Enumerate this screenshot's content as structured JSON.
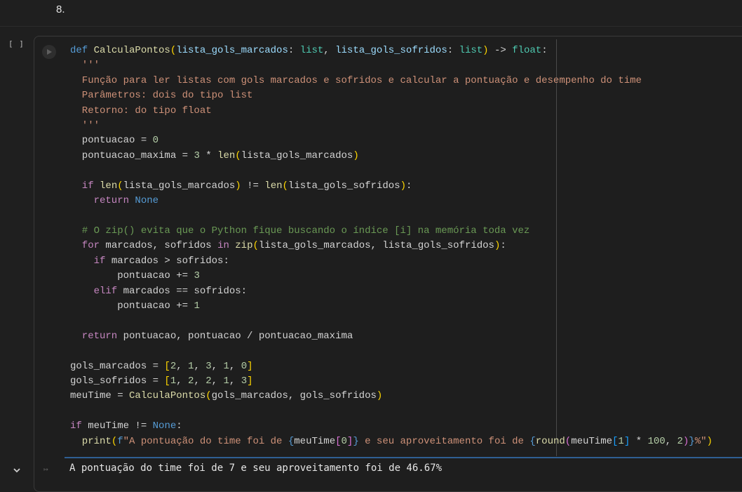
{
  "prev_cell": {
    "list_marker": "8."
  },
  "cell": {
    "execution_count": "[ ]",
    "code_lines": [
      [
        [
          "kw",
          "def "
        ],
        [
          "fn",
          "CalculaPontos"
        ],
        [
          "b1",
          "("
        ],
        [
          "pr",
          "lista_gols_marcados"
        ],
        [
          "tx",
          ": "
        ],
        [
          "ty",
          "list"
        ],
        [
          "tx",
          ", "
        ],
        [
          "pr",
          "lista_gols_sofridos"
        ],
        [
          "tx",
          ": "
        ],
        [
          "ty",
          "list"
        ],
        [
          "b1",
          ")"
        ],
        [
          "tx",
          " -> "
        ],
        [
          "ty",
          "float"
        ],
        [
          "tx",
          ":"
        ]
      ],
      [
        [
          "str",
          "  '''"
        ]
      ],
      [
        [
          "str",
          "  Função para ler listas com gols marcados e sofridos e calcular a pontuação e desempenho do time"
        ]
      ],
      [
        [
          "str",
          "  Parâmetros: dois do tipo list"
        ]
      ],
      [
        [
          "str",
          "  Retorno: do tipo float"
        ]
      ],
      [
        [
          "str",
          "  '''"
        ]
      ],
      [
        [
          "tx",
          "  pontuacao = "
        ],
        [
          "num",
          "0"
        ]
      ],
      [
        [
          "tx",
          "  pontuacao_maxima = "
        ],
        [
          "num",
          "3"
        ],
        [
          "tx",
          " * "
        ],
        [
          "fn",
          "len"
        ],
        [
          "b1",
          "("
        ],
        [
          "tx",
          "lista_gols_marcados"
        ],
        [
          "b1",
          ")"
        ]
      ],
      [
        [
          "tx",
          ""
        ]
      ],
      [
        [
          "ctl",
          "  if "
        ],
        [
          "fn",
          "len"
        ],
        [
          "b1",
          "("
        ],
        [
          "tx",
          "lista_gols_marcados"
        ],
        [
          "b1",
          ")"
        ],
        [
          "tx",
          " != "
        ],
        [
          "fn",
          "len"
        ],
        [
          "b1",
          "("
        ],
        [
          "tx",
          "lista_gols_sofridos"
        ],
        [
          "b1",
          ")"
        ],
        [
          "tx",
          ":"
        ]
      ],
      [
        [
          "ctl",
          "    return "
        ],
        [
          "kw",
          "None"
        ]
      ],
      [
        [
          "tx",
          ""
        ]
      ],
      [
        [
          "cm",
          "  # O zip() evita que o Python fique buscando o índice [i] na memória toda vez"
        ]
      ],
      [
        [
          "ctl",
          "  for "
        ],
        [
          "tx",
          "marcados, sofridos "
        ],
        [
          "ctl",
          "in "
        ],
        [
          "fn",
          "zip"
        ],
        [
          "b1",
          "("
        ],
        [
          "tx",
          "lista_gols_marcados, lista_gols_sofridos"
        ],
        [
          "b1",
          ")"
        ],
        [
          "tx",
          ":"
        ]
      ],
      [
        [
          "ctl",
          "    if "
        ],
        [
          "tx",
          "marcados > sofridos:"
        ]
      ],
      [
        [
          "tx",
          "        pontuacao += "
        ],
        [
          "num",
          "3"
        ]
      ],
      [
        [
          "ctl",
          "    elif "
        ],
        [
          "tx",
          "marcados == sofridos:"
        ]
      ],
      [
        [
          "tx",
          "        pontuacao += "
        ],
        [
          "num",
          "1"
        ]
      ],
      [
        [
          "tx",
          ""
        ]
      ],
      [
        [
          "ctl",
          "  return "
        ],
        [
          "tx",
          "pontuacao, pontuacao / pontuacao_maxima"
        ]
      ],
      [
        [
          "tx",
          ""
        ]
      ],
      [
        [
          "tx",
          "gols_marcados = "
        ],
        [
          "b1",
          "["
        ],
        [
          "num",
          "2"
        ],
        [
          "tx",
          ", "
        ],
        [
          "num",
          "1"
        ],
        [
          "tx",
          ", "
        ],
        [
          "num",
          "3"
        ],
        [
          "tx",
          ", "
        ],
        [
          "num",
          "1"
        ],
        [
          "tx",
          ", "
        ],
        [
          "num",
          "0"
        ],
        [
          "b1",
          "]"
        ]
      ],
      [
        [
          "tx",
          "gols_sofridos = "
        ],
        [
          "b1",
          "["
        ],
        [
          "num",
          "1"
        ],
        [
          "tx",
          ", "
        ],
        [
          "num",
          "2"
        ],
        [
          "tx",
          ", "
        ],
        [
          "num",
          "2"
        ],
        [
          "tx",
          ", "
        ],
        [
          "num",
          "1"
        ],
        [
          "tx",
          ", "
        ],
        [
          "num",
          "3"
        ],
        [
          "b1",
          "]"
        ]
      ],
      [
        [
          "tx",
          "meuTime = "
        ],
        [
          "fn",
          "CalculaPontos"
        ],
        [
          "b1",
          "("
        ],
        [
          "tx",
          "gols_marcados, gols_sofridos"
        ],
        [
          "b1",
          ")"
        ]
      ],
      [
        [
          "tx",
          ""
        ]
      ],
      [
        [
          "ctl",
          "if "
        ],
        [
          "tx",
          "meuTime != "
        ],
        [
          "kw",
          "None"
        ],
        [
          "tx",
          ":"
        ]
      ],
      [
        [
          "fn",
          "  print"
        ],
        [
          "b1",
          "("
        ],
        [
          "kw",
          "f"
        ],
        [
          "str",
          "\"A pontuação do time foi de "
        ],
        [
          "kw",
          "{"
        ],
        [
          "tx",
          "meuTime"
        ],
        [
          "b2",
          "["
        ],
        [
          "num",
          "0"
        ],
        [
          "b2",
          "]"
        ],
        [
          "kw",
          "}"
        ],
        [
          "str",
          " e seu aproveitamento foi de "
        ],
        [
          "kw",
          "{"
        ],
        [
          "fn",
          "round"
        ],
        [
          "b2",
          "("
        ],
        [
          "tx",
          "meuTime"
        ],
        [
          "b3",
          "["
        ],
        [
          "num",
          "1"
        ],
        [
          "b3",
          "]"
        ],
        [
          "tx",
          " * "
        ],
        [
          "num",
          "100"
        ],
        [
          "tx",
          ", "
        ],
        [
          "num",
          "2"
        ],
        [
          "b2",
          ")"
        ],
        [
          "kw",
          "}"
        ],
        [
          "str",
          "%\""
        ],
        [
          "b1",
          ")"
        ]
      ]
    ],
    "output_text": "A pontuação do time foi de 7 e seu aproveitamento foi de 46.67%"
  },
  "colors": {
    "background": "#1f1f1f",
    "output_separator": "#2f5f93"
  },
  "icons": {
    "run": "play-icon",
    "collapse": "chevron-down-icon",
    "output": "output-icon"
  }
}
